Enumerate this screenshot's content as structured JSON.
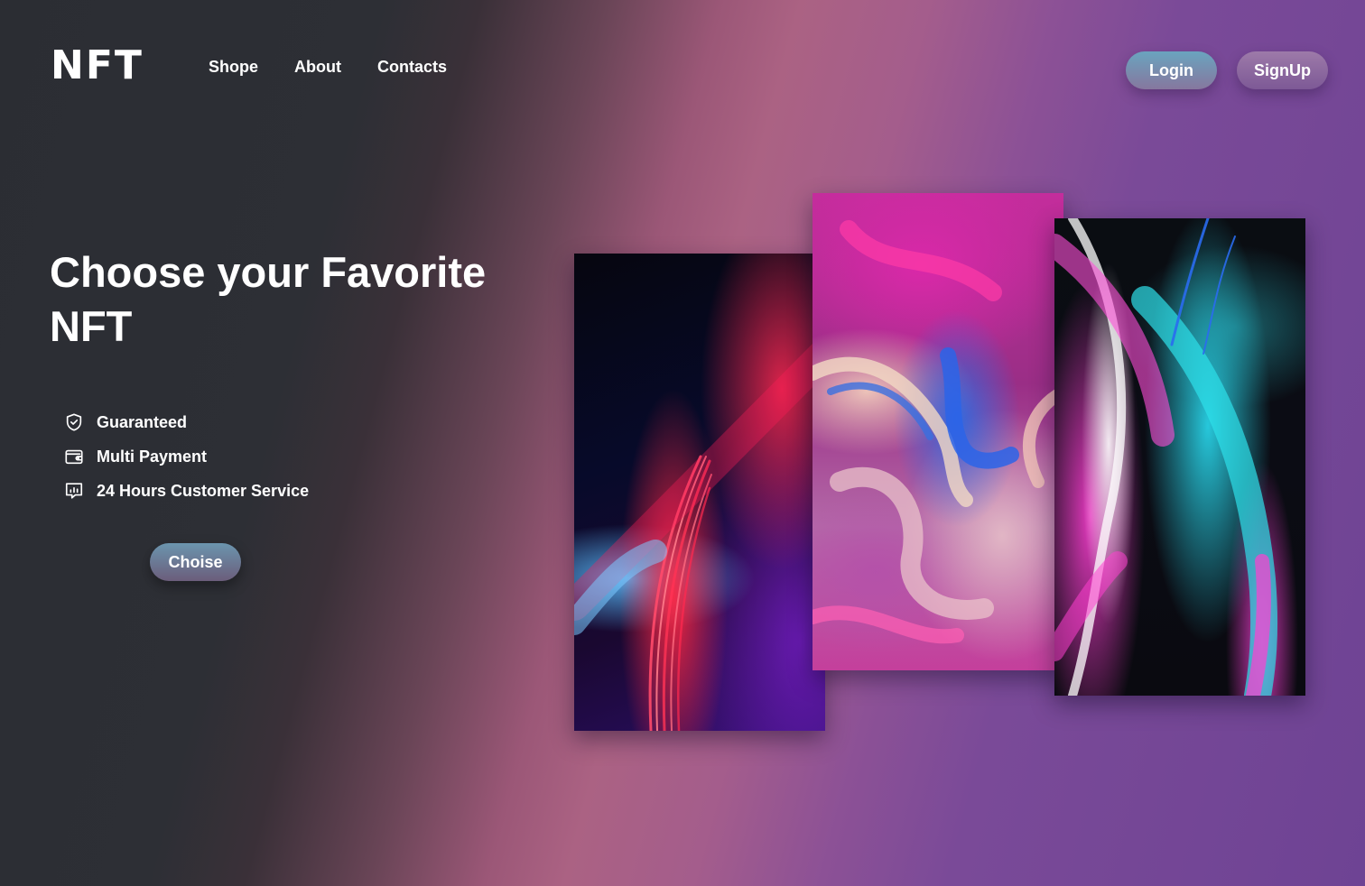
{
  "brand": {
    "logo_text": "NFT"
  },
  "nav": {
    "items": [
      {
        "label": "Shope"
      },
      {
        "label": "About"
      },
      {
        "label": "Contacts"
      }
    ]
  },
  "auth": {
    "login_label": "Login",
    "signup_label": "SignUp"
  },
  "hero": {
    "title": "Choose your Favorite NFT",
    "features": [
      {
        "icon": "shield-check-icon",
        "label": "Guaranteed"
      },
      {
        "icon": "wallet-icon",
        "label": "Multi Payment"
      },
      {
        "icon": "chat-chart-icon",
        "label": "24 Hours Customer Service"
      }
    ],
    "cta_label": "Choise"
  },
  "gallery": {
    "cards": [
      {
        "name": "nft-card-light-streaks"
      },
      {
        "name": "nft-card-fluid-marble"
      },
      {
        "name": "nft-card-neon-waves"
      }
    ]
  },
  "colors": {
    "background_dark": "#2b2d33",
    "background_pink": "#ab6283",
    "background_purple": "#6e4394",
    "text": "#ffffff"
  }
}
